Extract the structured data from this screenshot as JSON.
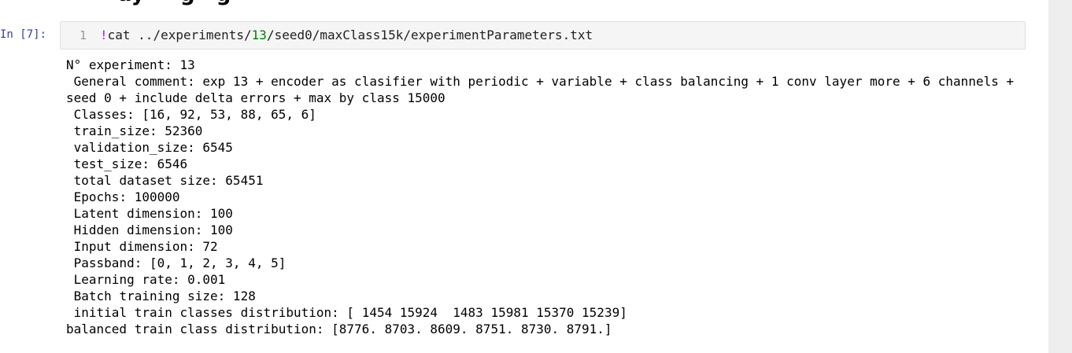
{
  "notebook": {
    "heading_fragment": "ay     g   g",
    "cell": {
      "prompt": "In [7]:",
      "line_number": "1",
      "code": {
        "bang": "!",
        "cmd": "cat ../experiments/",
        "num": "13",
        "rest": "/seed0/maxClass15k/experimentParameters.txt"
      }
    },
    "output_lines": [
      "N° experiment: 13",
      " General comment: exp 13 + encoder as clasifier with periodic + variable + class balancing + 1 conv layer more + 6 channels + seed 0 + include delta errors + max by class 15000",
      " Classes: [16, 92, 53, 88, 65, 6]",
      " train_size: 52360",
      " validation_size: 6545",
      " test_size: 6546",
      " total dataset size: 65451",
      " Epochs: 100000",
      " Latent dimension: 100",
      " Hidden dimension: 100",
      " Input dimension: 72",
      " Passband: [0, 1, 2, 3, 4, 5]",
      " Learning rate: 0.001",
      " Batch training size: 128",
      " initial train classes distribution: [ 1454 15924  1483 15981 15370 15239]",
      "balanced train class distribution: [8776. 8703. 8609. 8751. 8730. 8791.]"
    ]
  }
}
